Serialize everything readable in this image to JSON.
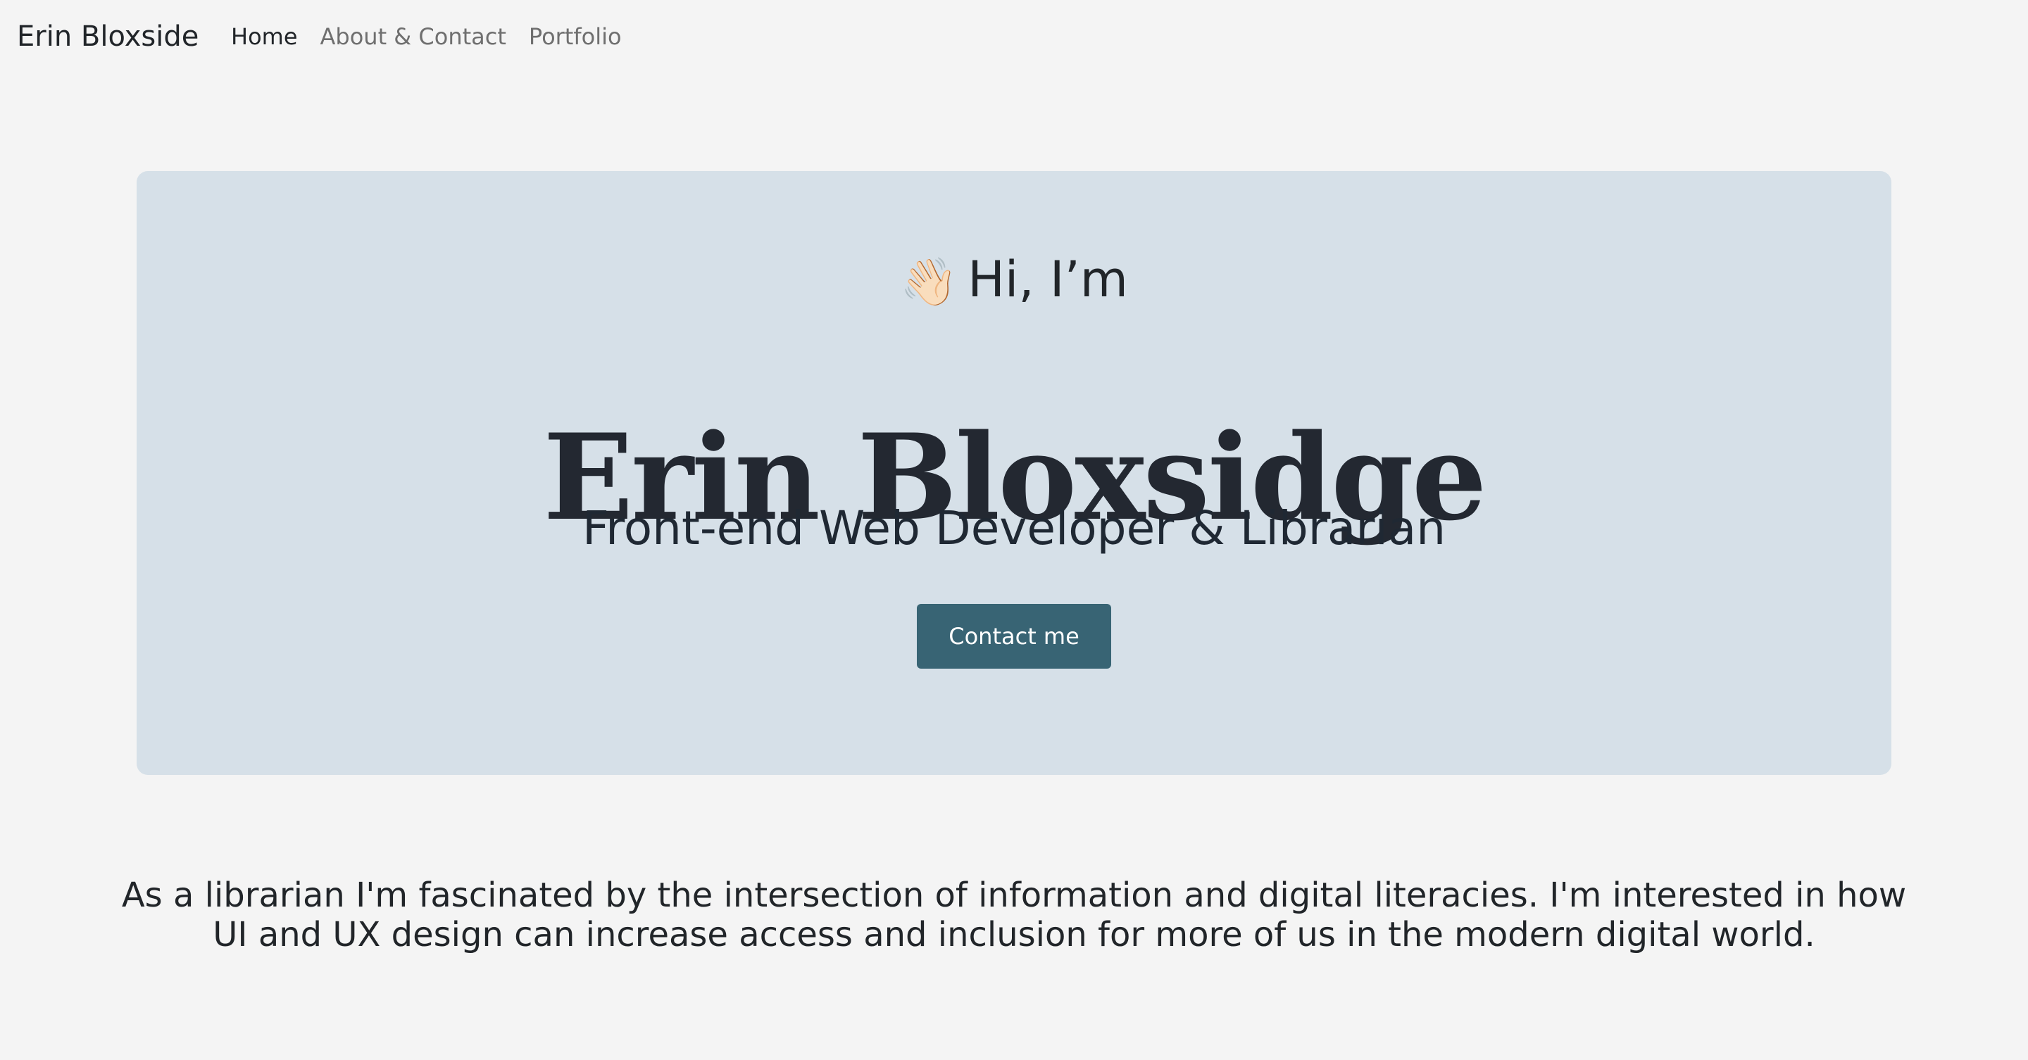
{
  "header": {
    "brand": "Erin Bloxside",
    "nav": [
      {
        "label": "Home"
      },
      {
        "label": "About & Contact"
      },
      {
        "label": "Portfolio"
      }
    ]
  },
  "hero": {
    "wave": "👋🏻",
    "greeting": "Hi, I’m",
    "name": "Erin Bloxsidge",
    "tagline": "Front-end Web Developer & Librarian",
    "contact_label": "Contact me"
  },
  "intro": {
    "text": "As a librarian I'm fascinated by the intersection of information and digital literacies. I'm interested in how UI and UX design can increase access and inclusion for more of us in the modern digital world."
  },
  "colors": {
    "page_bg": "#f4f4f4",
    "hero_bg": "#d6e0e8",
    "button_bg": "#386474",
    "text": "#212529",
    "nav_muted": "#6f6f6f"
  },
  "icons": {
    "wave": "waving-hand-icon"
  }
}
